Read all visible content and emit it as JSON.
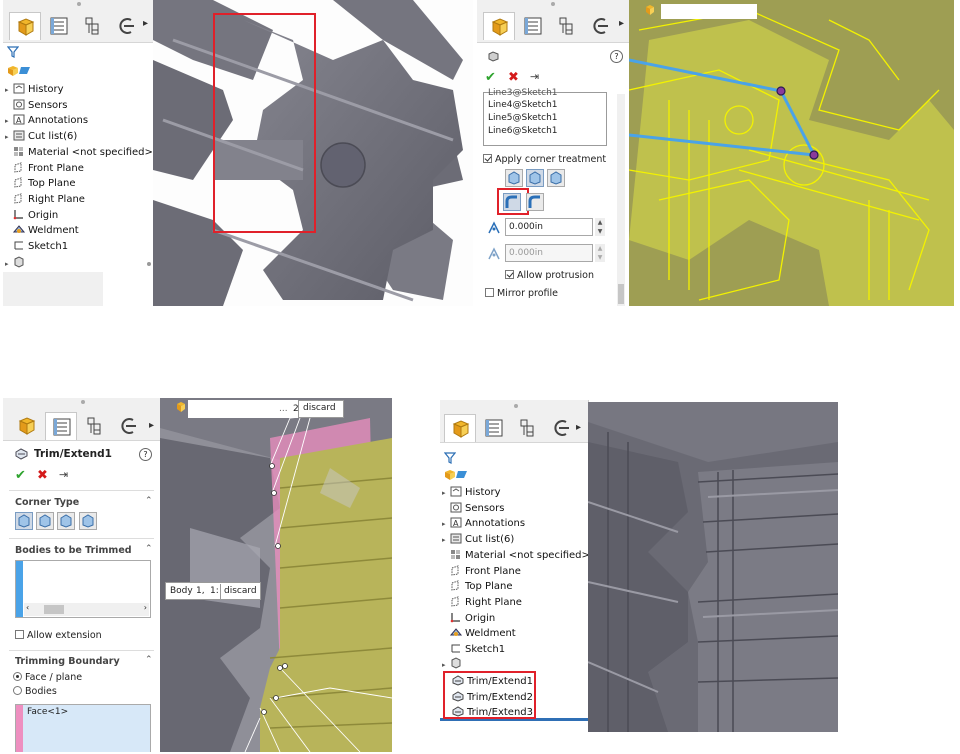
{
  "colors": {
    "accent_red": "#e0212a",
    "selection_blue": "#4aa3e8",
    "pink": "#ef8fc0",
    "solid_gray": "#6f6f7a",
    "yellow_highlight": "#f3f200",
    "olive_preview": "#b8b45a"
  },
  "tree": {
    "items": [
      "History",
      "Sensors",
      "Annotations",
      "Cut list(6)",
      "Material <not specified>",
      "Front Plane",
      "Top Plane",
      "Right Plane",
      "Origin",
      "Weldment",
      "Sketch1"
    ],
    "added_items": [
      "Trim/Extend1",
      "Trim/Extend2",
      "Trim/Extend3"
    ]
  },
  "profile_panel": {
    "selections": [
      "Line4@Sketch1",
      "Line5@Sketch1",
      "Line6@Sketch1"
    ],
    "apply_corner_label": "Apply corner treatment",
    "gap1_value": "0.000in",
    "gap2_value": "0.000in",
    "allow_protrusion_label": "Allow protrusion",
    "mirror_profile_label": "Mirror profile",
    "help": "?"
  },
  "trim_panel": {
    "title": "Trim/Extend1",
    "help": "?",
    "corner_type_label": "Corner Type",
    "bodies_trimmed_label": "Bodies to be Trimmed",
    "allow_extension_label": "Allow extension",
    "trimming_boundary_label": "Trimming Boundary",
    "face_plane_label": "Face / plane",
    "bodies_label": "Bodies",
    "face_item": "Face<1>"
  },
  "viewport_labels": {
    "callout_top_prefix": "...",
    "callout_top_num": "2:",
    "callout_top_value": "discard",
    "callout_body_text": "Body",
    "callout_body_n1": "1,",
    "callout_body_n2": "1:",
    "callout_body_value": "discard"
  }
}
